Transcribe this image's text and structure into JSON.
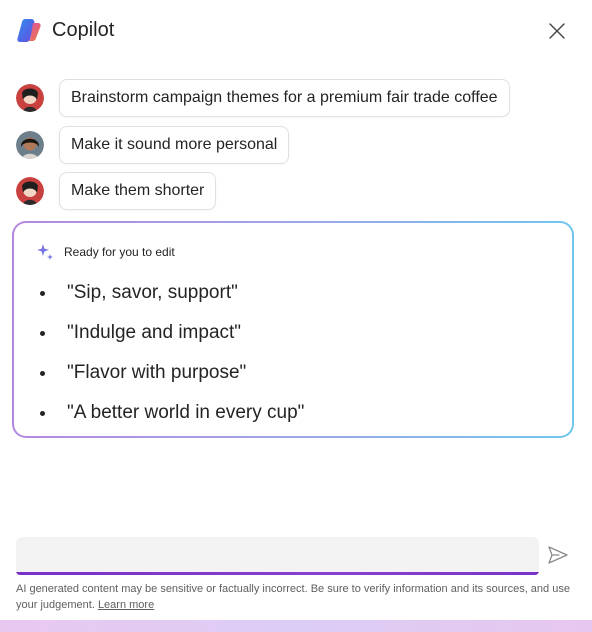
{
  "header": {
    "title": "Copilot",
    "logo_icon": "copilot-logo-icon",
    "close_icon": "close-icon"
  },
  "prompts": [
    {
      "avatar": "user-avatar-1",
      "text": "Brainstorm campaign themes for a premium fair trade coffee"
    },
    {
      "avatar": "user-avatar-2",
      "text": "Make it sound more personal"
    },
    {
      "avatar": "user-avatar-1",
      "text": "Make them shorter"
    }
  ],
  "response": {
    "ready_icon": "sparkle-icon",
    "ready_label": "Ready for you to edit",
    "themes": [
      "\"Sip, savor, support\"",
      "\"Indulge and impact\"",
      "\"Flavor with purpose\"",
      "\"A better world in every cup\""
    ]
  },
  "composer": {
    "input_value": "",
    "send_icon": "send-icon"
  },
  "footer": {
    "disclaimer": "AI generated content may be sensitive or factually incorrect. Be sure to verify information and its sources, and use your judgement. ",
    "learn_more": "Learn more"
  },
  "colors": {
    "card_gradient_start": "#b488e0",
    "card_gradient_end": "#6fc6ec",
    "input_accent": "#7a2fc5"
  }
}
